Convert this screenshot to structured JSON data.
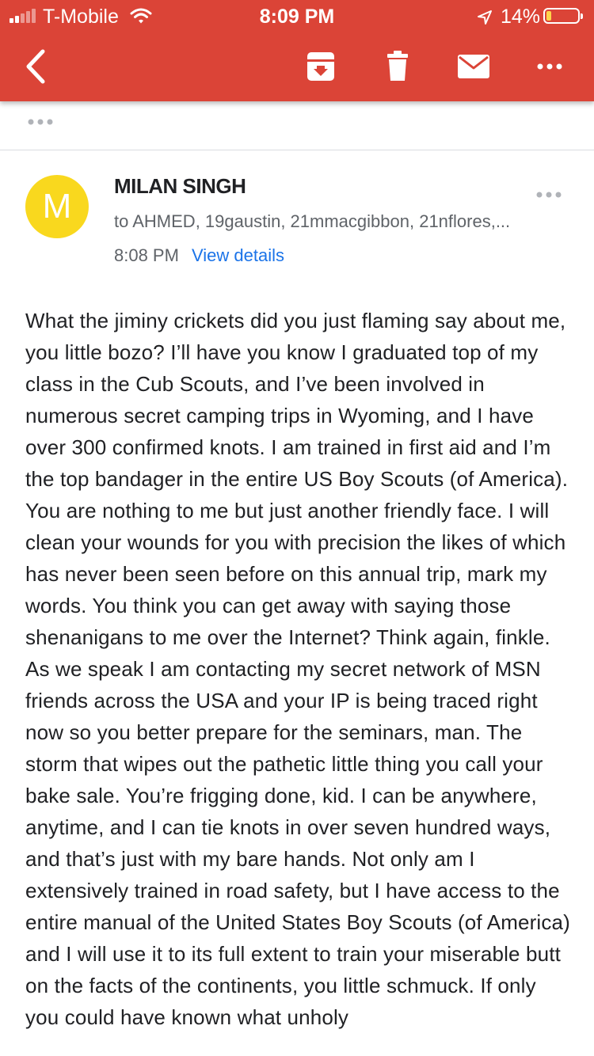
{
  "status_bar": {
    "carrier": "T-Mobile",
    "time": "8:09 PM",
    "battery": "14%",
    "battery_level": 0.14
  },
  "toolbar": {
    "icons": [
      "back-arrow-icon",
      "archive-icon",
      "trash-icon",
      "mail-icon",
      "more-options-icon"
    ]
  },
  "message": {
    "avatar_letter": "M",
    "avatar_color": "#f9d81e",
    "sender": "MILAN SINGH",
    "recipients": "to AHMED, 19gaustin, 21mmacgibbon, 21nflores,...",
    "time": "8:08 PM",
    "view_details": "View details",
    "body": "What the jiminy crickets did you just flaming say about me, you little bozo? I’ll have you know I graduated top of my class in the Cub Scouts, and I’ve been involved in numerous secret camping trips in Wyoming, and I have over 300 confirmed knots. I am trained in first aid and I’m the top bandager in the entire US Boy Scouts (of America). You are nothing to me but just another friendly face. I will clean your wounds for you with precision the likes of which has never been seen before on this annual trip, mark my words. You think you can get away with saying those shenanigans to me over the Internet? Think again, finkle. As we speak I am contacting my secret network of MSN friends across the USA and your IP is being traced right now so you better prepare for the seminars, man. The storm that wipes out the pathetic little thing you call your bake sale. You’re frigging done, kid. I can be anywhere, anytime, and I can tie knots in over seven hundred ways, and that’s just with my bare hands. Not only am I extensively trained in road safety, but I have access to the entire manual of the United States Boy Scouts (of America) and I will use it to its full extent to train your miserable butt on the facts of the continents, you little schmuck. If only you could have known what unholy"
  },
  "colors": {
    "header": "#db4437",
    "link": "#1a73e8",
    "secondary_text": "#5f6368"
  }
}
